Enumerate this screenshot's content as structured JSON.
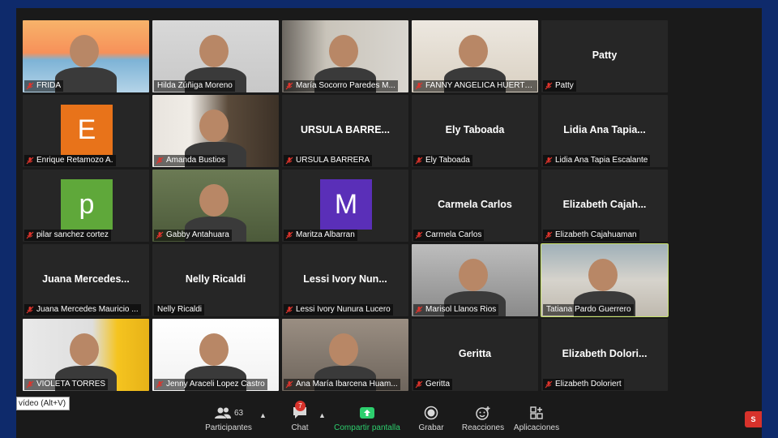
{
  "participants": [
    {
      "name": "FRIDA",
      "display": "",
      "muted": true,
      "kind": "video",
      "photo": "p-frida"
    },
    {
      "name": "Hilda Zúñiga Moreno",
      "display": "",
      "muted": false,
      "kind": "video",
      "photo": "p-hilda"
    },
    {
      "name": "María Socorro Paredes M...",
      "display": "",
      "muted": true,
      "kind": "video",
      "photo": "p-maria"
    },
    {
      "name": "FANNY ANGELICA HUERTO...",
      "display": "",
      "muted": true,
      "kind": "video",
      "photo": "p-fanny"
    },
    {
      "name": "Patty",
      "display": "Patty",
      "muted": true,
      "kind": "name"
    },
    {
      "name": "Enrique Retamozo A.",
      "display": "",
      "muted": true,
      "kind": "avatar",
      "letter": "E",
      "color": "#e8731a"
    },
    {
      "name": "Amanda Bustios",
      "display": "",
      "muted": true,
      "kind": "video",
      "photo": "p-amanda"
    },
    {
      "name": "URSULA BARRERA",
      "display": "URSULA BARRE...",
      "muted": true,
      "kind": "name"
    },
    {
      "name": "Ely Taboada",
      "display": "Ely Taboada",
      "muted": true,
      "kind": "name"
    },
    {
      "name": "Lidia Ana Tapia Escalante",
      "display": "Lidia Ana Tapia...",
      "muted": true,
      "kind": "name"
    },
    {
      "name": "pilar sanchez cortez",
      "display": "",
      "muted": true,
      "kind": "avatar",
      "letter": "p",
      "color": "#5fa83a"
    },
    {
      "name": "Gabby Antahuara",
      "display": "",
      "muted": true,
      "kind": "video",
      "photo": "p-gabby"
    },
    {
      "name": "Maritza Albarran",
      "display": "",
      "muted": true,
      "kind": "avatar",
      "letter": "M",
      "color": "#5a2fb8"
    },
    {
      "name": "Carmela Carlos",
      "display": "Carmela Carlos",
      "muted": true,
      "kind": "name"
    },
    {
      "name": "Elizabeth Cajahuaman",
      "display": "Elizabeth Cajah...",
      "muted": true,
      "kind": "name"
    },
    {
      "name": "Juana Mercedes Mauricio ...",
      "display": "Juana Mercedes...",
      "muted": true,
      "kind": "name"
    },
    {
      "name": "Nelly Ricaldi",
      "display": "Nelly Ricaldi",
      "muted": false,
      "kind": "name"
    },
    {
      "name": "Lessi Ivory Nunura Lucero",
      "display": "Lessi Ivory Nun...",
      "muted": true,
      "kind": "name"
    },
    {
      "name": "Marisol Llanos Rios",
      "display": "",
      "muted": true,
      "kind": "video",
      "photo": "p-marisol"
    },
    {
      "name": "Tatiana Pardo Guerrero",
      "display": "",
      "muted": false,
      "kind": "video",
      "photo": "p-tatiana",
      "speaking": true
    },
    {
      "name": "VIOLETA TORRES",
      "display": "",
      "muted": true,
      "kind": "video",
      "photo": "p-violeta"
    },
    {
      "name": "Jenny Araceli Lopez Castro",
      "display": "",
      "muted": true,
      "kind": "video",
      "photo": "p-jenny"
    },
    {
      "name": "Ana María Ibarcena Huam...",
      "display": "",
      "muted": true,
      "kind": "video",
      "photo": "p-ana"
    },
    {
      "name": "Geritta",
      "display": "Geritta",
      "muted": true,
      "kind": "name"
    },
    {
      "name": "Elizabeth Doloriert",
      "display": "Elizabeth Dolori...",
      "muted": true,
      "kind": "name"
    }
  ],
  "toolbar": {
    "participants_label": "Participantes",
    "participants_count": "63",
    "chat_label": "Chat",
    "chat_badge": "7",
    "share_label": "Compartir pantalla",
    "record_label": "Grabar",
    "reactions_label": "Reacciones",
    "apps_label": "Aplicaciones",
    "tooltip": "vídeo (Alt+V)",
    "end_label": "S"
  },
  "colors": {
    "background": "#0e2a6b",
    "share_green": "#2dcf6e",
    "muted_red": "#e0342c",
    "speaking_outline": "#c9e36a"
  }
}
